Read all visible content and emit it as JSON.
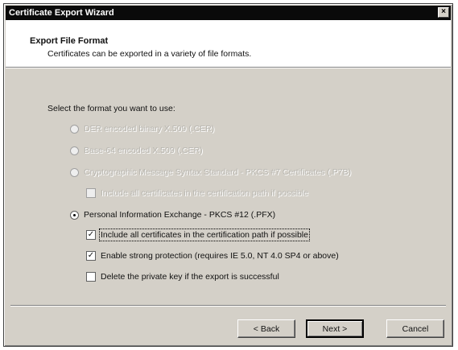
{
  "window": {
    "title": "Certificate Export Wizard",
    "close_label": "×"
  },
  "header": {
    "title": "Export File Format",
    "subtitle": "Certificates can be exported in a variety of file formats."
  },
  "prompt": "Select the format you want to use:",
  "formats": [
    {
      "label": "DER encoded binary X.509 (.CER)",
      "enabled": false,
      "selected": false
    },
    {
      "label": "Base-64 encoded X.509 (.CER)",
      "enabled": false,
      "selected": false
    },
    {
      "label": "Cryptographic Message Syntax Standard - PKCS #7 Certificates (.P7B)",
      "enabled": false,
      "selected": false
    },
    {
      "label": "Personal Information Exchange - PKCS #12 (.PFX)",
      "enabled": true,
      "selected": true
    }
  ],
  "options": [
    {
      "label": "Include all certificates in the certification path if possible",
      "checked": false,
      "enabled": false
    },
    {
      "label": "Include all certificates in the certification path if possible",
      "checked": true,
      "enabled": true
    },
    {
      "label": "Enable strong protection (requires IE 5.0, NT 4.0 SP4 or above)",
      "checked": true,
      "enabled": true
    },
    {
      "label": "Delete the private key if the export is successful",
      "checked": false,
      "enabled": true
    }
  ],
  "buttons": {
    "back": "< Back",
    "next": "Next >",
    "cancel": "Cancel"
  },
  "check_mark": "✓"
}
